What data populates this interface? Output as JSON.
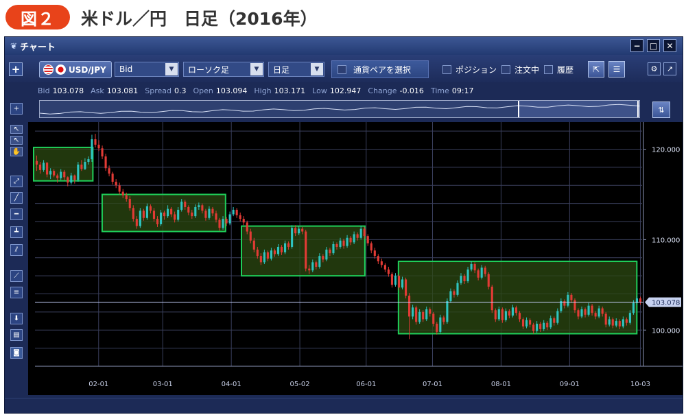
{
  "figure": {
    "badge": "図２",
    "title": "米ドル／円　日足（2016年）"
  },
  "window": {
    "title": "チャート",
    "controls": {
      "minimize": "−",
      "restore": "□",
      "close": "✕"
    }
  },
  "toolbar": {
    "add": "+",
    "pair": "USD/JPY",
    "price_type": "Bid",
    "chart_type": "ローソク足",
    "timeframe": "日足",
    "select_pair": "通貨ペアを選択",
    "checkboxes": [
      "ポジション",
      "注文中",
      "履歴"
    ]
  },
  "quote": {
    "bid_label": "Bid",
    "bid": "103.078",
    "ask_label": "Ask",
    "ask": "103.081",
    "spread_label": "Spread",
    "spread": "0.3",
    "open_label": "Open",
    "open": "103.094",
    "high_label": "High",
    "high": "103.171",
    "low_label": "Low",
    "low": "102.947",
    "change_label": "Change",
    "change": "-0.016",
    "time_label": "Time",
    "time": "09:17"
  },
  "colors": {
    "bull": "#2ec4c0",
    "bear": "#e23b35",
    "box_stroke": "#1fcf5a",
    "box_fill": "#2c4a12",
    "grid": "#3a3f5c",
    "price_line": "#c8d4ff"
  },
  "chart_data": {
    "type": "candlestick",
    "x_ticks": [
      "02-01",
      "03-01",
      "04-01",
      "05-02",
      "06-01",
      "07-01",
      "08-01",
      "09-01",
      "10-03"
    ],
    "y_ticks": [
      "120.000",
      "110.000",
      "100.000"
    ],
    "ylim": [
      96.0,
      123.0
    ],
    "current_price": "103.078",
    "grid": true,
    "ranges": [
      {
        "from": "01-04",
        "to": "01-28",
        "low": 116.5,
        "high": 120.2
      },
      {
        "from": "02-04",
        "to": "03-28",
        "low": 110.9,
        "high": 115.0
      },
      {
        "from": "04-07",
        "to": "05-30",
        "low": 106.0,
        "high": 111.5
      },
      {
        "from": "06-17",
        "to": "09-30",
        "low": 99.6,
        "high": 107.6
      }
    ],
    "candles": [
      [
        118.7,
        119.3,
        117.6,
        118.3
      ],
      [
        118.3,
        118.6,
        117.3,
        117.7
      ],
      [
        117.7,
        118.8,
        117.5,
        118.5
      ],
      [
        118.5,
        118.6,
        116.9,
        117.2
      ],
      [
        117.2,
        117.9,
        116.7,
        117.6
      ],
      [
        117.6,
        117.8,
        116.9,
        117.1
      ],
      [
        117.1,
        117.3,
        116.3,
        116.8
      ],
      [
        116.8,
        117.8,
        116.6,
        117.5
      ],
      [
        117.5,
        117.7,
        116.6,
        116.9
      ],
      [
        116.9,
        117.0,
        115.9,
        116.3
      ],
      [
        116.3,
        117.4,
        116.1,
        117.1
      ],
      [
        117.1,
        117.2,
        116.2,
        116.6
      ],
      [
        116.6,
        118.6,
        116.4,
        118.3
      ],
      [
        118.3,
        118.8,
        117.6,
        117.8
      ],
      [
        117.8,
        119.0,
        117.7,
        118.6
      ],
      [
        118.6,
        119.2,
        118.3,
        118.9
      ],
      [
        118.9,
        121.6,
        118.6,
        121.1
      ],
      [
        121.1,
        121.7,
        120.2,
        120.5
      ],
      [
        120.5,
        121.0,
        119.8,
        120.1
      ],
      [
        120.1,
        120.4,
        118.9,
        119.2
      ],
      [
        119.2,
        119.5,
        117.6,
        117.9
      ],
      [
        117.9,
        118.2,
        117.0,
        117.3
      ],
      [
        117.3,
        117.5,
        116.1,
        116.4
      ],
      [
        116.4,
        116.7,
        115.7,
        116.0
      ],
      [
        116.0,
        116.3,
        115.0,
        115.3
      ],
      [
        115.3,
        115.6,
        114.6,
        114.9
      ],
      [
        114.9,
        115.2,
        114.2,
        114.5
      ],
      [
        114.5,
        114.8,
        113.2,
        113.5
      ],
      [
        113.5,
        113.8,
        112.0,
        112.3
      ],
      [
        112.3,
        112.6,
        111.2,
        111.5
      ],
      [
        111.5,
        113.5,
        111.3,
        113.2
      ],
      [
        113.2,
        113.4,
        112.1,
        112.4
      ],
      [
        112.4,
        114.0,
        112.2,
        113.7
      ],
      [
        113.7,
        113.9,
        112.9,
        113.2
      ],
      [
        113.2,
        113.5,
        112.0,
        112.3
      ],
      [
        112.3,
        112.6,
        111.4,
        111.7
      ],
      [
        111.7,
        113.3,
        111.5,
        113.0
      ],
      [
        113.0,
        113.2,
        112.2,
        112.6
      ],
      [
        112.6,
        113.8,
        112.4,
        113.4
      ],
      [
        113.4,
        113.6,
        112.5,
        112.8
      ],
      [
        112.8,
        113.1,
        111.9,
        112.2
      ],
      [
        112.2,
        113.6,
        112.0,
        113.3
      ],
      [
        113.3,
        114.5,
        113.1,
        114.2
      ],
      [
        114.2,
        114.4,
        113.3,
        113.6
      ],
      [
        113.6,
        113.8,
        112.7,
        113.0
      ],
      [
        113.0,
        113.3,
        112.3,
        112.6
      ],
      [
        112.6,
        113.9,
        112.4,
        113.6
      ],
      [
        113.6,
        114.1,
        113.3,
        113.8
      ],
      [
        113.8,
        114.0,
        112.9,
        113.2
      ],
      [
        113.2,
        113.4,
        112.1,
        112.4
      ],
      [
        112.4,
        113.7,
        112.2,
        113.4
      ],
      [
        113.4,
        113.6,
        112.6,
        112.9
      ],
      [
        112.9,
        113.2,
        111.9,
        112.2
      ],
      [
        112.2,
        112.4,
        111.0,
        111.3
      ],
      [
        111.3,
        112.6,
        111.1,
        112.3
      ],
      [
        112.3,
        112.5,
        111.5,
        111.8
      ],
      [
        111.8,
        113.1,
        111.6,
        112.8
      ],
      [
        112.8,
        113.6,
        112.6,
        113.3
      ],
      [
        113.3,
        113.5,
        112.4,
        112.7
      ],
      [
        112.7,
        113.0,
        112.0,
        112.3
      ],
      [
        112.3,
        112.6,
        111.6,
        111.9
      ],
      [
        111.9,
        112.1,
        110.6,
        110.9
      ],
      [
        110.9,
        111.2,
        109.6,
        109.9
      ],
      [
        109.9,
        110.2,
        108.6,
        108.9
      ],
      [
        108.9,
        109.2,
        107.9,
        108.2
      ],
      [
        108.2,
        108.5,
        107.2,
        107.5
      ],
      [
        107.5,
        108.9,
        107.3,
        108.6
      ],
      [
        108.6,
        108.8,
        107.6,
        107.9
      ],
      [
        107.9,
        109.1,
        107.7,
        108.8
      ],
      [
        108.8,
        109.0,
        108.1,
        108.4
      ],
      [
        108.4,
        109.5,
        108.2,
        109.2
      ],
      [
        109.2,
        109.4,
        108.3,
        108.6
      ],
      [
        108.6,
        109.9,
        108.4,
        109.6
      ],
      [
        109.6,
        109.8,
        108.9,
        109.2
      ],
      [
        109.2,
        111.6,
        109.0,
        111.3
      ],
      [
        111.3,
        111.6,
        110.4,
        110.7
      ],
      [
        110.7,
        111.5,
        110.5,
        111.2
      ],
      [
        111.2,
        111.4,
        110.6,
        110.9
      ],
      [
        110.9,
        111.1,
        106.5,
        106.8
      ],
      [
        106.8,
        107.2,
        106.2,
        106.6
      ],
      [
        106.6,
        107.8,
        106.4,
        107.5
      ],
      [
        107.5,
        107.7,
        106.7,
        107.0
      ],
      [
        107.0,
        108.5,
        106.8,
        108.2
      ],
      [
        108.2,
        108.4,
        107.5,
        107.8
      ],
      [
        107.8,
        109.2,
        107.6,
        108.9
      ],
      [
        108.9,
        109.1,
        108.2,
        108.5
      ],
      [
        108.5,
        109.8,
        108.3,
        109.5
      ],
      [
        109.5,
        109.7,
        108.9,
        109.2
      ],
      [
        109.2,
        110.2,
        109.0,
        109.9
      ],
      [
        109.9,
        110.1,
        109.0,
        109.3
      ],
      [
        109.3,
        110.5,
        109.1,
        110.2
      ],
      [
        110.2,
        110.4,
        109.4,
        109.7
      ],
      [
        109.7,
        110.9,
        109.5,
        110.6
      ],
      [
        110.6,
        110.8,
        109.9,
        110.2
      ],
      [
        110.2,
        111.5,
        110.0,
        111.2
      ],
      [
        111.2,
        111.4,
        110.1,
        110.4
      ],
      [
        110.4,
        110.6,
        109.3,
        109.6
      ],
      [
        109.6,
        109.8,
        108.5,
        108.8
      ],
      [
        108.8,
        109.1,
        107.9,
        108.2
      ],
      [
        108.2,
        108.4,
        107.3,
        107.6
      ],
      [
        107.6,
        107.9,
        106.9,
        107.2
      ],
      [
        107.2,
        107.4,
        106.4,
        106.7
      ],
      [
        106.7,
        107.0,
        105.9,
        106.2
      ],
      [
        106.2,
        106.4,
        104.7,
        105.0
      ],
      [
        105.0,
        106.3,
        104.8,
        106.0
      ],
      [
        106.0,
        106.2,
        104.4,
        104.7
      ],
      [
        104.7,
        105.9,
        104.5,
        105.6
      ],
      [
        105.6,
        105.8,
        103.5,
        103.8
      ],
      [
        103.8,
        104.1,
        99.0,
        101.5
      ],
      [
        101.5,
        102.8,
        101.2,
        102.5
      ],
      [
        102.5,
        102.7,
        100.6,
        100.9
      ],
      [
        100.9,
        102.3,
        100.7,
        102.0
      ],
      [
        102.0,
        102.2,
        100.9,
        101.2
      ],
      [
        101.2,
        102.6,
        101.0,
        102.3
      ],
      [
        102.3,
        102.5,
        101.5,
        101.8
      ],
      [
        101.8,
        102.0,
        100.4,
        100.7
      ],
      [
        100.7,
        100.9,
        99.5,
        99.8
      ],
      [
        99.8,
        101.7,
        99.6,
        101.4
      ],
      [
        101.4,
        101.6,
        100.6,
        100.9
      ],
      [
        100.9,
        103.5,
        100.7,
        103.2
      ],
      [
        103.2,
        104.6,
        103.0,
        104.3
      ],
      [
        104.3,
        104.5,
        103.6,
        103.9
      ],
      [
        103.9,
        105.5,
        103.7,
        105.2
      ],
      [
        105.2,
        106.3,
        105.0,
        106.0
      ],
      [
        106.0,
        106.2,
        105.1,
        105.4
      ],
      [
        105.4,
        107.0,
        105.2,
        106.7
      ],
      [
        106.7,
        107.6,
        106.5,
        107.3
      ],
      [
        107.3,
        107.5,
        106.3,
        106.6
      ],
      [
        106.6,
        106.8,
        105.5,
        105.8
      ],
      [
        105.8,
        107.2,
        105.6,
        106.9
      ],
      [
        106.9,
        107.1,
        105.9,
        106.2
      ],
      [
        106.2,
        106.4,
        104.5,
        104.8
      ],
      [
        104.8,
        105.0,
        101.9,
        102.2
      ],
      [
        102.2,
        102.4,
        100.9,
        101.2
      ],
      [
        101.2,
        102.6,
        101.0,
        102.3
      ],
      [
        102.3,
        102.5,
        100.8,
        101.1
      ],
      [
        101.1,
        102.4,
        100.9,
        102.1
      ],
      [
        102.1,
        102.3,
        101.3,
        101.6
      ],
      [
        101.6,
        102.8,
        101.4,
        102.5
      ],
      [
        102.5,
        102.7,
        101.6,
        101.9
      ],
      [
        101.9,
        102.1,
        100.9,
        101.2
      ],
      [
        101.2,
        101.4,
        100.1,
        100.4
      ],
      [
        100.4,
        101.4,
        100.2,
        101.1
      ],
      [
        101.1,
        101.3,
        100.3,
        100.6
      ],
      [
        100.6,
        100.8,
        99.6,
        99.9
      ],
      [
        99.9,
        101.0,
        99.7,
        100.7
      ],
      [
        100.7,
        100.9,
        99.8,
        100.1
      ],
      [
        100.1,
        101.1,
        99.9,
        100.8
      ],
      [
        100.8,
        101.0,
        100.0,
        100.3
      ],
      [
        100.3,
        101.6,
        100.1,
        101.3
      ],
      [
        101.3,
        101.5,
        100.5,
        100.8
      ],
      [
        100.8,
        102.4,
        100.6,
        102.1
      ],
      [
        102.1,
        103.5,
        101.9,
        103.2
      ],
      [
        103.2,
        103.4,
        102.4,
        102.7
      ],
      [
        102.7,
        104.2,
        102.5,
        103.9
      ],
      [
        103.9,
        104.1,
        103.0,
        103.3
      ],
      [
        103.3,
        103.5,
        101.9,
        102.2
      ],
      [
        102.2,
        102.4,
        101.2,
        101.5
      ],
      [
        101.5,
        102.6,
        101.3,
        102.3
      ],
      [
        102.3,
        102.5,
        101.4,
        101.7
      ],
      [
        101.7,
        103.0,
        101.5,
        102.7
      ],
      [
        102.7,
        102.9,
        101.6,
        101.9
      ],
      [
        101.9,
        102.1,
        101.2,
        101.5
      ],
      [
        101.5,
        102.7,
        101.3,
        102.4
      ],
      [
        102.4,
        102.6,
        101.5,
        101.8
      ],
      [
        101.8,
        102.0,
        100.3,
        100.6
      ],
      [
        100.6,
        101.5,
        100.4,
        101.2
      ],
      [
        101.2,
        101.4,
        100.2,
        100.5
      ],
      [
        100.5,
        101.3,
        100.3,
        101.0
      ],
      [
        101.0,
        101.2,
        100.1,
        100.4
      ],
      [
        100.4,
        101.5,
        100.2,
        101.2
      ],
      [
        101.2,
        101.4,
        100.5,
        100.8
      ],
      [
        100.8,
        102.2,
        100.6,
        101.9
      ],
      [
        101.9,
        103.3,
        101.7,
        103.0
      ],
      [
        103.0,
        103.8,
        102.8,
        103.5
      ],
      [
        103.5,
        103.7,
        102.8,
        103.1
      ]
    ]
  }
}
